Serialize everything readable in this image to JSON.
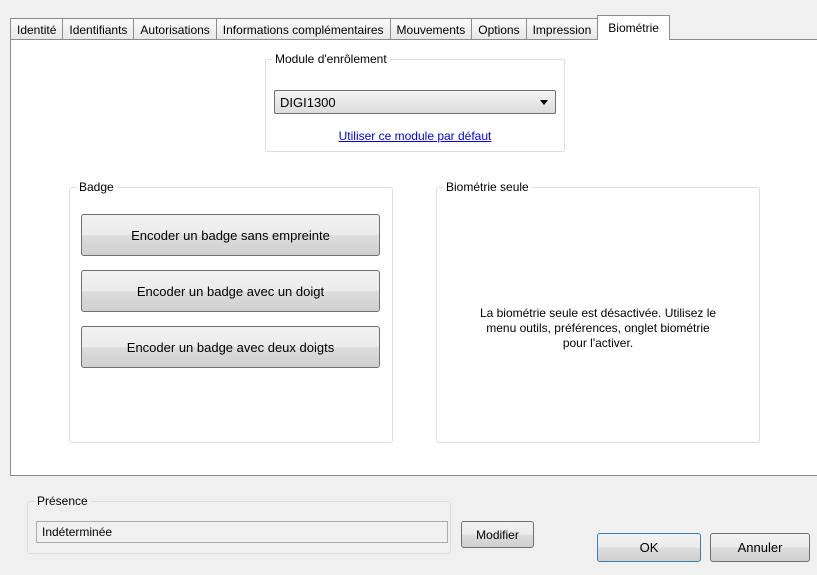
{
  "tabs": [
    {
      "label": "Identité"
    },
    {
      "label": "Identifiants"
    },
    {
      "label": "Autorisations"
    },
    {
      "label": "Informations complémentaires"
    },
    {
      "label": "Mouvements"
    },
    {
      "label": "Options"
    },
    {
      "label": "Impression"
    },
    {
      "label": "Biométrie",
      "active": true
    }
  ],
  "enrollment": {
    "legend": "Module d'enrôlement",
    "selected": "DIGI1300",
    "default_link": "Utiliser ce module par défaut"
  },
  "badge": {
    "legend": "Badge",
    "buttons": [
      "Encoder un badge sans empreinte",
      "Encoder un badge avec un doigt",
      "Encoder un badge avec deux doigts"
    ]
  },
  "biometry_only": {
    "legend": "Biométrie seule",
    "message": [
      "La biométrie seule est désactivée. Utilisez le",
      "menu outils, préférences, onglet biométrie",
      "pour l'activer."
    ]
  },
  "presence": {
    "legend": "Présence",
    "value": "Indéterminée",
    "modify_label": "Modifier"
  },
  "dialog": {
    "ok_label": "OK",
    "cancel_label": "Annuler"
  }
}
